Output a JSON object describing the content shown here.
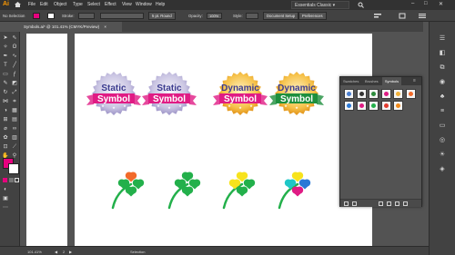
{
  "app": {
    "logo": "Ai"
  },
  "menu": [
    "File",
    "Edit",
    "Object",
    "Type",
    "Select",
    "Effect",
    "View",
    "Window",
    "Help"
  ],
  "workspace": "Essentials Classic",
  "control_bar": {
    "selection_label": "No Selection",
    "stroke_label": "Stroke:",
    "brush_label": "5 pt. Round",
    "opacity_label": "Opacity:",
    "opacity_value": "100%",
    "style_label": "Style:",
    "doc_setup": "Document Setup",
    "preferences": "Preferences"
  },
  "document_tab": {
    "title": "Symbols.ai* @ 101.41% (CMYK/Preview)",
    "close": "×"
  },
  "panel": {
    "tabs": [
      "Swatches",
      "Brushes",
      "Symbols"
    ],
    "menu": "≡",
    "thumbs": [
      "banner-blue",
      "character",
      "tree",
      "badge-static",
      "badge-dynamic",
      "clover-mix",
      "flower-blue",
      "flower-pink",
      "clover-green",
      "clover-red",
      "badge-orange"
    ]
  },
  "badges": [
    {
      "line1": "Static",
      "line2": "Symbol",
      "ribbon": "#e01b84",
      "burst": "#b9b4d6",
      "text": "#3b3b8f"
    },
    {
      "line1": "Static",
      "line2": "Symbol",
      "ribbon": "#e01b84",
      "burst": "#b9b4d6",
      "text": "#3b3b8f"
    },
    {
      "line1": "Dynamic",
      "line2": "Symbol",
      "ribbon": "#e01b84",
      "burst": "#f3b23a",
      "text": "#3b3b8f"
    },
    {
      "line1": "Dynamic",
      "line2": "Symbol",
      "ribbon": "#1e8f3d",
      "burst": "#f3b23a",
      "text": "#3b3b8f"
    }
  ],
  "clovers": [
    {
      "petals": [
        "#f26a2a",
        "#23b04b",
        "#23b04b",
        "#23b04b"
      ]
    },
    {
      "petals": [
        "#23b04b",
        "#23b04b",
        "#23b04b",
        "#23b04b"
      ]
    },
    {
      "petals": [
        "#f7e31c",
        "#23b04b",
        "#23b04b",
        "#f7e31c"
      ]
    },
    {
      "petals": [
        "#f7e31c",
        "#2a79d6",
        "#e01b84",
        "#1fc7c7"
      ]
    }
  ],
  "status": {
    "zoom": "101.41%",
    "page": "2",
    "tool": "Selection"
  },
  "colors": {
    "fill": "#e6007e",
    "accent": "#ff9a00"
  }
}
